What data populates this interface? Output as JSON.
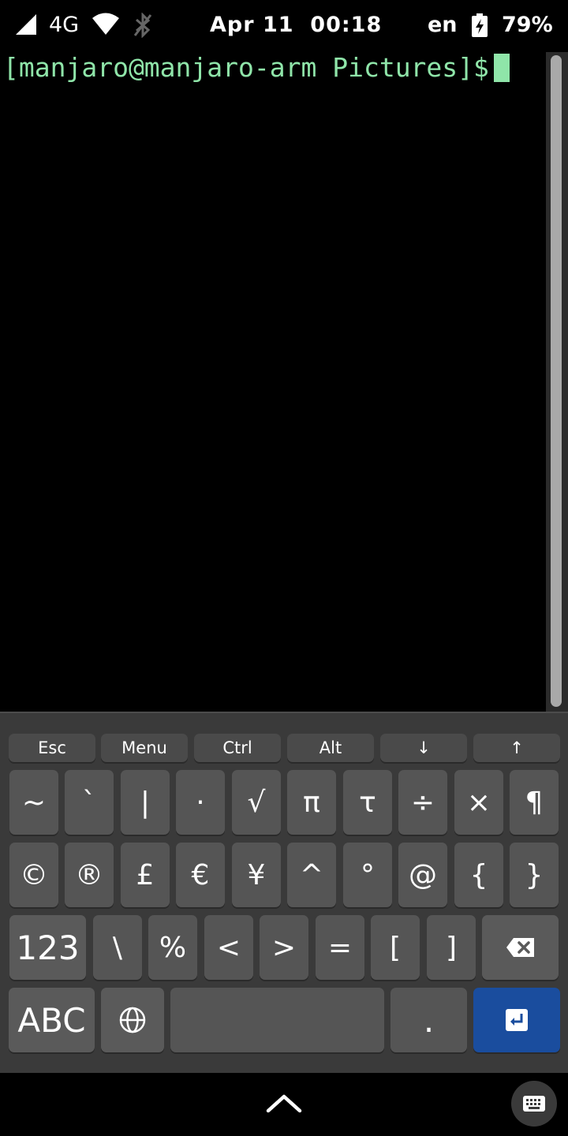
{
  "status_bar": {
    "network_type": "4G",
    "datetime": "Apr 11  00:18",
    "language": "en",
    "battery": "79%",
    "icons": [
      "signal-icon",
      "wifi-icon",
      "bluetooth-icon",
      "battery-charging-icon"
    ]
  },
  "terminal": {
    "prompt": "[manjaro@manjaro-arm Pictures]$",
    "text_color": "#8fe5a9",
    "background": "#000000"
  },
  "keyboard": {
    "control_row": [
      "Esc",
      "Menu",
      "Ctrl",
      "Alt",
      "↓",
      "↑"
    ],
    "row1": [
      "~",
      "`",
      "|",
      "·",
      "√",
      "π",
      "τ",
      "÷",
      "×",
      "¶"
    ],
    "row2": [
      "©",
      "®",
      "£",
      "€",
      "¥",
      "^",
      "°",
      "@",
      "{",
      "}"
    ],
    "row3": [
      "123",
      "\\",
      "%",
      "<",
      ">",
      "=",
      "[",
      "]"
    ],
    "row4": {
      "abc": "ABC",
      "period": "."
    },
    "enter_color": "#1a4d9e",
    "icons": [
      "backspace-icon",
      "globe-icon",
      "enter-icon"
    ]
  },
  "bottom_bar": {
    "icons": [
      "chevron-up-icon",
      "keyboard-icon"
    ]
  }
}
